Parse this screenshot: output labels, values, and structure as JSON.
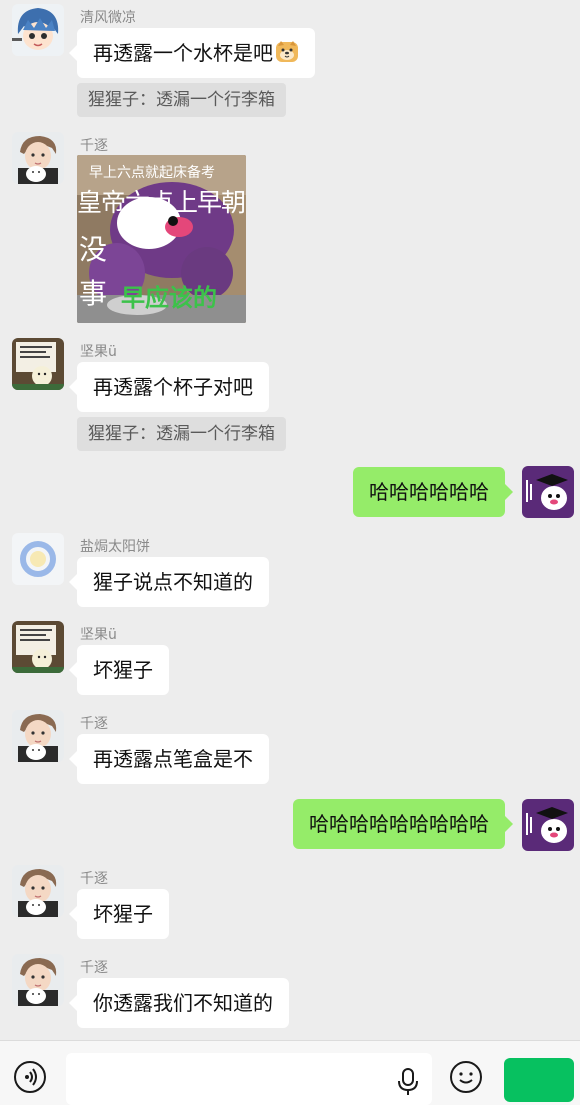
{
  "messages": [
    {
      "type": "incoming",
      "sender": "清风微凉",
      "avatar": "anime-boy-avatar",
      "text": "再透露一个水杯是吧",
      "emoji": "doge-emoji"
    },
    {
      "type": "quote",
      "text": "猩猩子：透漏一个行李箱"
    },
    {
      "type": "sticker",
      "sender": "千逐",
      "avatar": "boy-cat-avatar",
      "lines": [
        "早上六点就起床备考",
        "皇帝六点上早朝",
        "没",
        "事",
        "早应该的"
      ]
    },
    {
      "type": "incoming",
      "sender": "坚果ü",
      "avatar": "cartoon-avatar",
      "text": "再透露个杯子对吧"
    },
    {
      "type": "quote",
      "text": "猩猩子：透漏一个行李箱"
    },
    {
      "type": "outgoing",
      "avatar": "purple-avatar",
      "text": "哈哈哈哈哈哈"
    },
    {
      "type": "incoming",
      "sender": "盐焗太阳饼",
      "avatar": "blurred-avatar",
      "text": "猩子说点不知道的"
    },
    {
      "type": "incoming",
      "sender": "坚果ü",
      "avatar": "cartoon-avatar",
      "text": "坏猩子"
    },
    {
      "type": "incoming",
      "sender": "千逐",
      "avatar": "boy-cat-avatar",
      "text": "再透露点笔盒是不"
    },
    {
      "type": "outgoing",
      "avatar": "purple-avatar",
      "text": "哈哈哈哈哈哈哈哈哈"
    },
    {
      "type": "incoming",
      "sender": "千逐",
      "avatar": "boy-cat-avatar",
      "text": "坏猩子"
    },
    {
      "type": "incoming",
      "sender": "千逐",
      "avatar": "boy-cat-avatar",
      "text": "你透露我们不知道的"
    }
  ],
  "input_bar": {
    "placeholder": "",
    "send_label": "",
    "icons": [
      "voice-icon",
      "microphone-icon",
      "emoji-icon"
    ]
  },
  "colors": {
    "background": "#ededed",
    "incoming_bubble": "#ffffff",
    "outgoing_bubble": "#95ec69",
    "quote_bg": "#dedede",
    "send_button": "#07c160"
  }
}
